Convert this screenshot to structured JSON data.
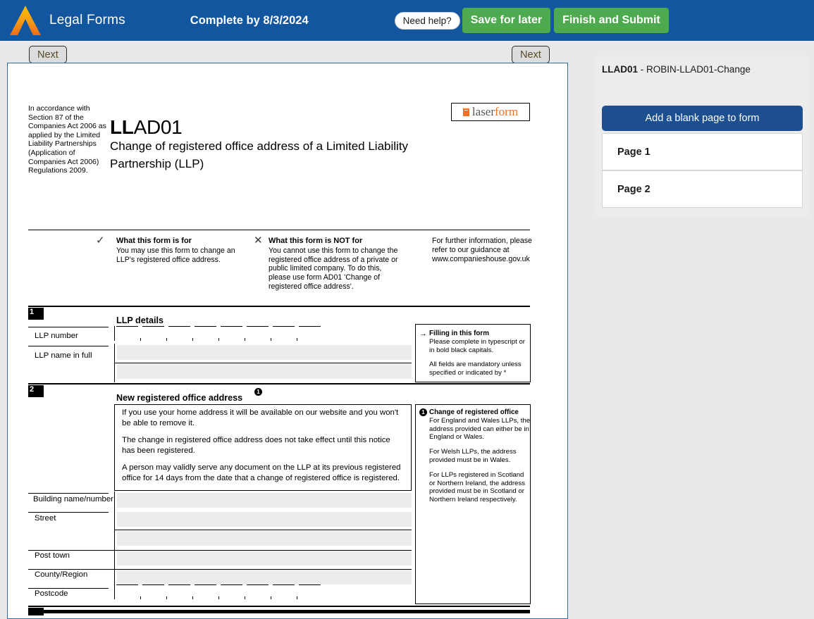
{
  "header": {
    "brand": "Legal Forms",
    "deadline": "Complete by 8/3/2024",
    "need_help_label": "Need help?",
    "save_label": "Save for later",
    "submit_label": "Finish and Submit",
    "brand_blue": "#11569e",
    "green": "#4eaa4e"
  },
  "toolbar": {
    "next_left_label": "Next",
    "next_right_label": "Next"
  },
  "form": {
    "accordance": "In accordance with Section 87 of the Companies Act 2006 as applied by the Limited Liability Partnerships (Application of Companies Act 2006) Regulations 2009.",
    "code_bold": "LL",
    "code_light": "AD01",
    "subtitle": "Change of registered office address of a Limited Liability Partnership (LLP)",
    "laserform_part1": "laser",
    "laserform_part2": "form",
    "for_block": {
      "check_glyph": "✓",
      "heading": "What this form is for",
      "body": "You may use this form to change an LLP's registered office address."
    },
    "not_for_block": {
      "cross_glyph": "✕",
      "heading": "What this form is NOT for",
      "body": "You cannot use this form to change the registered office address of a private or public limited company. To do this, please use form AD01 'Change of registered office address'."
    },
    "further_info": "For further information, please refer to our guidance at www.companieshouse.gov.uk",
    "section1": {
      "number": "1",
      "heading": "LLP details",
      "llp_number_label": "LLP number",
      "llp_number_value": "",
      "llp_number_cells": 8,
      "llp_name_label": "LLP name in full",
      "llp_name_value": "",
      "llp_name_value2": ""
    },
    "filling_note": {
      "arrow": "→",
      "heading": "Filling in this form",
      "p1": "Please complete in typescript or in bold black capitals.",
      "p2": "All fields are mandatory unless specified or indicated by *"
    },
    "section2": {
      "number": "2",
      "heading": "New registered office address",
      "note_ref": "1",
      "p1": "If you use your home address it will be available on our website and you won't be able to remove it.",
      "p2": "The change in registered office address does not take effect until this notice has been registered.",
      "p3": "A person may validly serve any document on the LLP at its previous registered office for 14 days from the date that a change of registered office is registered.",
      "fields": [
        {
          "label": "Building name/number",
          "value": ""
        },
        {
          "label": "Street",
          "value": ""
        },
        {
          "label": "",
          "value": ""
        },
        {
          "label": "Post town",
          "value": ""
        },
        {
          "label": "County/Region",
          "value": ""
        }
      ],
      "postcode_label": "Postcode",
      "postcode_value": "",
      "postcode_cells": 8
    },
    "registered_office_note": {
      "mark": "1",
      "heading": "Change of registered office",
      "p1": "For England and Wales LLPs, the address provided can either be in England or Wales.",
      "p2": "For Welsh LLPs, the address provided must be in Wales.",
      "p3": "For LLPs registered in Scotland or Northern Ireland, the address provided must be in Scotland or Northern Ireland respectively."
    }
  },
  "sidebar": {
    "form_code": "LLAD01",
    "separator": " - ",
    "form_name": "ROBIN-LLAD01-Change",
    "add_blank_label": "Add a blank page to form",
    "pages": [
      {
        "label": "Page 1"
      },
      {
        "label": "Page 2"
      }
    ],
    "accent": "#1d4e8f"
  }
}
